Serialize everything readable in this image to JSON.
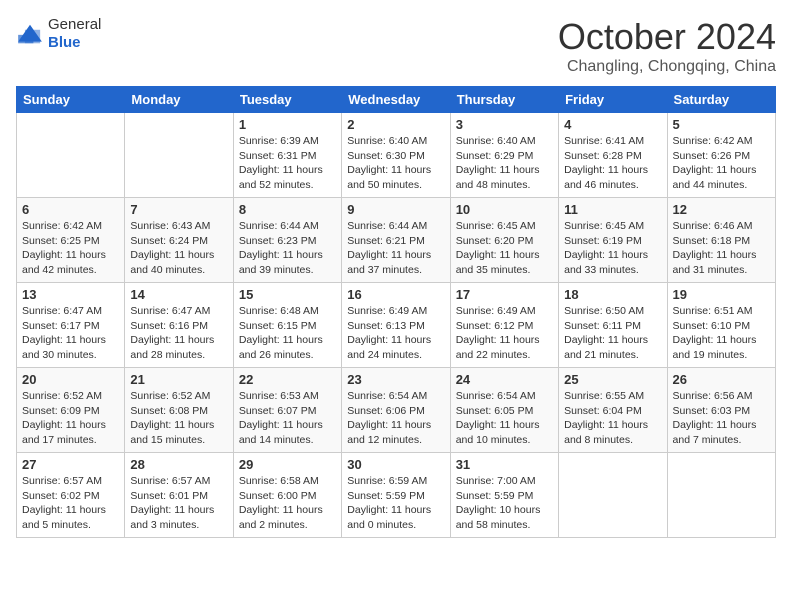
{
  "header": {
    "logo_general": "General",
    "logo_blue": "Blue",
    "month_title": "October 2024",
    "location": "Changling, Chongqing, China"
  },
  "days_of_week": [
    "Sunday",
    "Monday",
    "Tuesday",
    "Wednesday",
    "Thursday",
    "Friday",
    "Saturday"
  ],
  "weeks": [
    [
      {
        "day": "",
        "sunrise": "",
        "sunset": "",
        "daylight": ""
      },
      {
        "day": "",
        "sunrise": "",
        "sunset": "",
        "daylight": ""
      },
      {
        "day": "1",
        "sunrise": "Sunrise: 6:39 AM",
        "sunset": "Sunset: 6:31 PM",
        "daylight": "Daylight: 11 hours and 52 minutes."
      },
      {
        "day": "2",
        "sunrise": "Sunrise: 6:40 AM",
        "sunset": "Sunset: 6:30 PM",
        "daylight": "Daylight: 11 hours and 50 minutes."
      },
      {
        "day": "3",
        "sunrise": "Sunrise: 6:40 AM",
        "sunset": "Sunset: 6:29 PM",
        "daylight": "Daylight: 11 hours and 48 minutes."
      },
      {
        "day": "4",
        "sunrise": "Sunrise: 6:41 AM",
        "sunset": "Sunset: 6:28 PM",
        "daylight": "Daylight: 11 hours and 46 minutes."
      },
      {
        "day": "5",
        "sunrise": "Sunrise: 6:42 AM",
        "sunset": "Sunset: 6:26 PM",
        "daylight": "Daylight: 11 hours and 44 minutes."
      }
    ],
    [
      {
        "day": "6",
        "sunrise": "Sunrise: 6:42 AM",
        "sunset": "Sunset: 6:25 PM",
        "daylight": "Daylight: 11 hours and 42 minutes."
      },
      {
        "day": "7",
        "sunrise": "Sunrise: 6:43 AM",
        "sunset": "Sunset: 6:24 PM",
        "daylight": "Daylight: 11 hours and 40 minutes."
      },
      {
        "day": "8",
        "sunrise": "Sunrise: 6:44 AM",
        "sunset": "Sunset: 6:23 PM",
        "daylight": "Daylight: 11 hours and 39 minutes."
      },
      {
        "day": "9",
        "sunrise": "Sunrise: 6:44 AM",
        "sunset": "Sunset: 6:21 PM",
        "daylight": "Daylight: 11 hours and 37 minutes."
      },
      {
        "day": "10",
        "sunrise": "Sunrise: 6:45 AM",
        "sunset": "Sunset: 6:20 PM",
        "daylight": "Daylight: 11 hours and 35 minutes."
      },
      {
        "day": "11",
        "sunrise": "Sunrise: 6:45 AM",
        "sunset": "Sunset: 6:19 PM",
        "daylight": "Daylight: 11 hours and 33 minutes."
      },
      {
        "day": "12",
        "sunrise": "Sunrise: 6:46 AM",
        "sunset": "Sunset: 6:18 PM",
        "daylight": "Daylight: 11 hours and 31 minutes."
      }
    ],
    [
      {
        "day": "13",
        "sunrise": "Sunrise: 6:47 AM",
        "sunset": "Sunset: 6:17 PM",
        "daylight": "Daylight: 11 hours and 30 minutes."
      },
      {
        "day": "14",
        "sunrise": "Sunrise: 6:47 AM",
        "sunset": "Sunset: 6:16 PM",
        "daylight": "Daylight: 11 hours and 28 minutes."
      },
      {
        "day": "15",
        "sunrise": "Sunrise: 6:48 AM",
        "sunset": "Sunset: 6:15 PM",
        "daylight": "Daylight: 11 hours and 26 minutes."
      },
      {
        "day": "16",
        "sunrise": "Sunrise: 6:49 AM",
        "sunset": "Sunset: 6:13 PM",
        "daylight": "Daylight: 11 hours and 24 minutes."
      },
      {
        "day": "17",
        "sunrise": "Sunrise: 6:49 AM",
        "sunset": "Sunset: 6:12 PM",
        "daylight": "Daylight: 11 hours and 22 minutes."
      },
      {
        "day": "18",
        "sunrise": "Sunrise: 6:50 AM",
        "sunset": "Sunset: 6:11 PM",
        "daylight": "Daylight: 11 hours and 21 minutes."
      },
      {
        "day": "19",
        "sunrise": "Sunrise: 6:51 AM",
        "sunset": "Sunset: 6:10 PM",
        "daylight": "Daylight: 11 hours and 19 minutes."
      }
    ],
    [
      {
        "day": "20",
        "sunrise": "Sunrise: 6:52 AM",
        "sunset": "Sunset: 6:09 PM",
        "daylight": "Daylight: 11 hours and 17 minutes."
      },
      {
        "day": "21",
        "sunrise": "Sunrise: 6:52 AM",
        "sunset": "Sunset: 6:08 PM",
        "daylight": "Daylight: 11 hours and 15 minutes."
      },
      {
        "day": "22",
        "sunrise": "Sunrise: 6:53 AM",
        "sunset": "Sunset: 6:07 PM",
        "daylight": "Daylight: 11 hours and 14 minutes."
      },
      {
        "day": "23",
        "sunrise": "Sunrise: 6:54 AM",
        "sunset": "Sunset: 6:06 PM",
        "daylight": "Daylight: 11 hours and 12 minutes."
      },
      {
        "day": "24",
        "sunrise": "Sunrise: 6:54 AM",
        "sunset": "Sunset: 6:05 PM",
        "daylight": "Daylight: 11 hours and 10 minutes."
      },
      {
        "day": "25",
        "sunrise": "Sunrise: 6:55 AM",
        "sunset": "Sunset: 6:04 PM",
        "daylight": "Daylight: 11 hours and 8 minutes."
      },
      {
        "day": "26",
        "sunrise": "Sunrise: 6:56 AM",
        "sunset": "Sunset: 6:03 PM",
        "daylight": "Daylight: 11 hours and 7 minutes."
      }
    ],
    [
      {
        "day": "27",
        "sunrise": "Sunrise: 6:57 AM",
        "sunset": "Sunset: 6:02 PM",
        "daylight": "Daylight: 11 hours and 5 minutes."
      },
      {
        "day": "28",
        "sunrise": "Sunrise: 6:57 AM",
        "sunset": "Sunset: 6:01 PM",
        "daylight": "Daylight: 11 hours and 3 minutes."
      },
      {
        "day": "29",
        "sunrise": "Sunrise: 6:58 AM",
        "sunset": "Sunset: 6:00 PM",
        "daylight": "Daylight: 11 hours and 2 minutes."
      },
      {
        "day": "30",
        "sunrise": "Sunrise: 6:59 AM",
        "sunset": "Sunset: 5:59 PM",
        "daylight": "Daylight: 11 hours and 0 minutes."
      },
      {
        "day": "31",
        "sunrise": "Sunrise: 7:00 AM",
        "sunset": "Sunset: 5:59 PM",
        "daylight": "Daylight: 10 hours and 58 minutes."
      },
      {
        "day": "",
        "sunrise": "",
        "sunset": "",
        "daylight": ""
      },
      {
        "day": "",
        "sunrise": "",
        "sunset": "",
        "daylight": ""
      }
    ]
  ]
}
